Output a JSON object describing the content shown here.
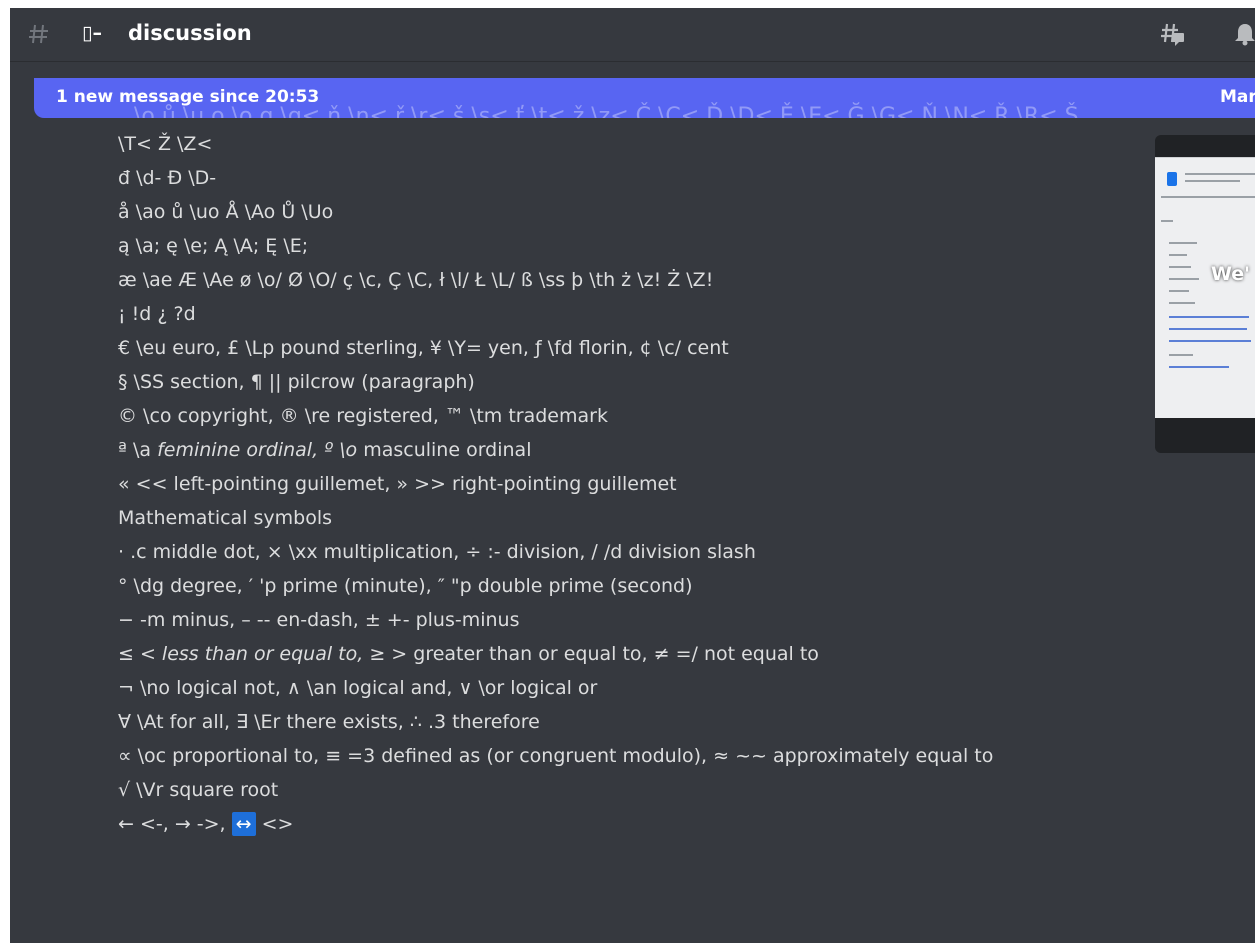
{
  "header": {
    "channel_glyph": "▯–",
    "channel_name": "discussion"
  },
  "banner": {
    "ghost_text": "\\o ů \\u o \\o g \\g< ň \\n< ř \\r< š \\s< ť \\t< ž \\z< Č \\C< Ď \\D< Ě \\E< Ğ \\G< Ň \\N< Ř \\R< Š",
    "text": "1 new message since 20:53",
    "mark_label": "Mark"
  },
  "attachment": {
    "overlay_text": "We'"
  },
  "messages": {
    "l0": "\\T< Ž \\Z<",
    "l1": "đ \\d- Đ \\D-",
    "l2": "å \\ao ů \\uo Å \\Ao Ů \\Uo",
    "l3": "ą \\a; ę \\e; Ą \\A; Ę \\E;",
    "l4": "æ \\ae Æ \\Ae ø \\o/ Ø \\O/ ç \\c, Ç \\C, ł \\l/ Ł \\L/ ß \\ss þ \\th ż \\z! Ż \\Z!",
    "l5": "¡ !d ¿ ?d",
    "l6": "€ \\eu euro, £ \\Lp pound sterling, ¥ \\Y= yen, ƒ \\fd florin, ¢ \\c/ cent",
    "l7": "§ \\SS section, ¶ || pilcrow (paragraph)",
    "l8": "© \\co copyright, ® \\re registered, ™ \\tm trademark",
    "l9a": "ª \\a ",
    "l9b": "feminine ordinal, º \\o",
    "l9c": " masculine ordinal",
    "l10": "« << left-pointing guillemet, » >> right-pointing guillemet",
    "l11": "Mathematical symbols",
    "l12": "· .c middle dot, × \\xx multiplication, ÷ :- division, ∕ /d division slash",
    "l13": "° \\dg degree, ′ 'p prime (minute), ″ \"p double prime (second)",
    "l14": "− -m minus, – -- en-dash, ± +- plus-minus",
    "l15a": "≤ < ",
    "l15b": "less than or equal to,",
    "l15c": " ≥ > greater than or equal to, ≠ =/ not equal to",
    "l16": "¬ \\no logical not, ∧ \\an logical and, ∨ \\or logical or",
    "l17": "∀ \\At for all, ∃ \\Er there exists, ∴ .3 therefore",
    "l18": "∝ \\oc proportional to, ≡ =3 defined as (or congruent modulo), ≈ ~~ approximately equal to",
    "l19": "√ \\Vr square root",
    "l20a": "← <-, → ->, ",
    "l20b": "↔",
    "l20c": " <>"
  }
}
